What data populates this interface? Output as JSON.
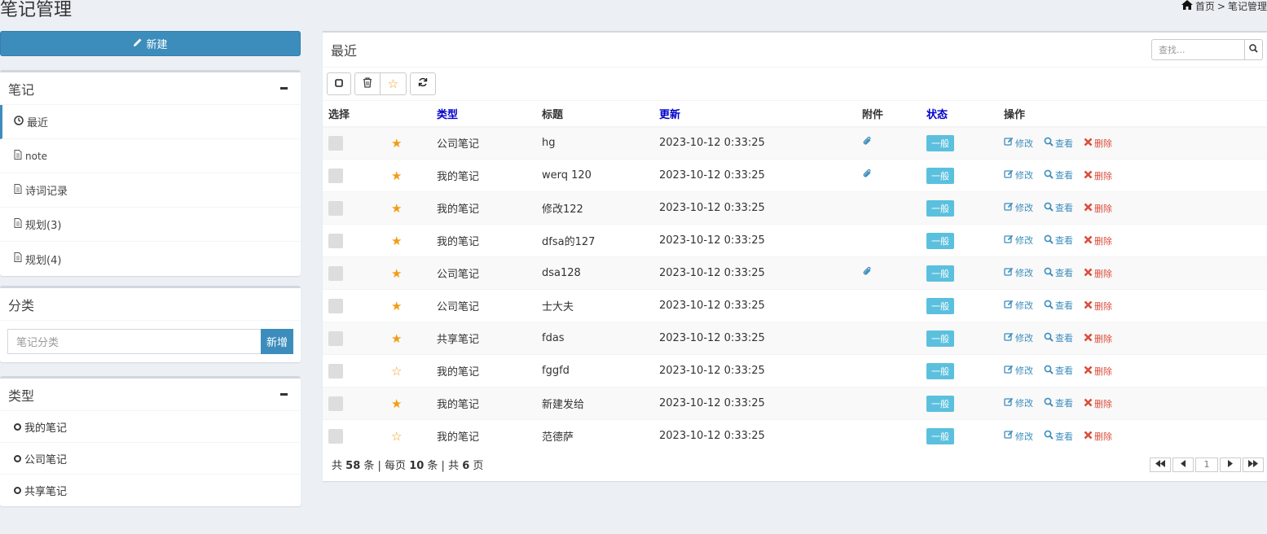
{
  "header": {
    "title": "笔记管理",
    "breadcrumb_home": "首页",
    "breadcrumb_sep": ">",
    "breadcrumb_current": "笔记管理"
  },
  "sidebar": {
    "new_button": "新建",
    "notes_box": {
      "title": "笔记",
      "items": [
        {
          "label": "最近",
          "icon": "clock-icon"
        },
        {
          "label": "note",
          "icon": "file-icon"
        },
        {
          "label": "诗词记录",
          "icon": "file-icon"
        },
        {
          "label": "规划(3)",
          "icon": "file-icon"
        },
        {
          "label": "规划(4)",
          "icon": "file-icon"
        }
      ]
    },
    "category_box": {
      "title": "分类",
      "input_placeholder": "笔记分类",
      "add_button": "新增"
    },
    "type_box": {
      "title": "类型",
      "items": [
        "我的笔记",
        "公司笔记",
        "共享笔记"
      ]
    }
  },
  "main": {
    "title": "最近",
    "search_placeholder": "查找...",
    "columns": {
      "select": "选择",
      "type": "类型",
      "title": "标题",
      "updated": "更新",
      "attachment": "附件",
      "status": "状态",
      "actions": "操作"
    },
    "actions": {
      "edit": "修改",
      "view": "查看",
      "delete": "删除"
    },
    "rows": [
      {
        "starred": true,
        "type": "公司笔记",
        "title": "hg",
        "updated": "2023-10-12 0:33:25",
        "attachment": true,
        "status": "一般"
      },
      {
        "starred": true,
        "type": "我的笔记",
        "title": "werq 120",
        "updated": "2023-10-12 0:33:25",
        "attachment": true,
        "status": "一般"
      },
      {
        "starred": true,
        "type": "我的笔记",
        "title": "修改122",
        "updated": "2023-10-12 0:33:25",
        "attachment": false,
        "status": "一般"
      },
      {
        "starred": true,
        "type": "我的笔记",
        "title": "dfsa的127",
        "updated": "2023-10-12 0:33:25",
        "attachment": false,
        "status": "一般"
      },
      {
        "starred": true,
        "type": "公司笔记",
        "title": "dsa128",
        "updated": "2023-10-12 0:33:25",
        "attachment": true,
        "status": "一般"
      },
      {
        "starred": true,
        "type": "公司笔记",
        "title": "士大夫",
        "updated": "2023-10-12 0:33:25",
        "attachment": false,
        "status": "一般"
      },
      {
        "starred": true,
        "type": "共享笔记",
        "title": "fdas",
        "updated": "2023-10-12 0:33:25",
        "attachment": false,
        "status": "一般"
      },
      {
        "starred": false,
        "type": "我的笔记",
        "title": "fggfd",
        "updated": "2023-10-12 0:33:25",
        "attachment": false,
        "status": "一般"
      },
      {
        "starred": true,
        "type": "我的笔记",
        "title": "新建发给",
        "updated": "2023-10-12 0:33:25",
        "attachment": false,
        "status": "一般"
      },
      {
        "starred": false,
        "type": "我的笔记",
        "title": "范德萨",
        "updated": "2023-10-12 0:33:25",
        "attachment": false,
        "status": "一般"
      }
    ],
    "footer": {
      "total_prefix": "共",
      "total": "58",
      "total_suffix": "条 | 每页",
      "per_page": "10",
      "per_page_suffix": "条 | 共",
      "pages": "6",
      "pages_suffix": "页",
      "current_page": "1"
    }
  },
  "colors": {
    "primary": "#3c8dbc",
    "star": "#f39c12",
    "badge": "#5bc0de",
    "danger": "#dd4b39",
    "link_header": "#0000cc"
  }
}
